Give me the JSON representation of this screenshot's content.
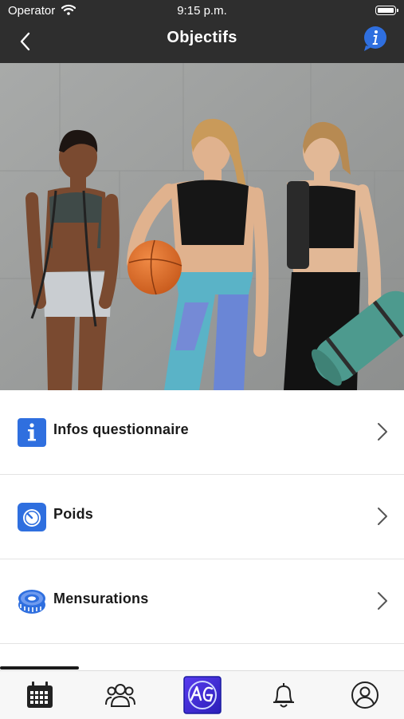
{
  "status_bar": {
    "carrier": "Operator",
    "time": "9:15 p.m.",
    "wifi_icon": "wifi-icon",
    "battery_icon": "battery-icon"
  },
  "nav": {
    "title": "Objectifs",
    "back_icon": "chevron-left-icon",
    "info_icon": "info-bubble-icon"
  },
  "hero": {
    "description_icon": "hero-photo"
  },
  "menu": {
    "items": [
      {
        "label": "Infos questionnaire",
        "icon": "info-square-icon"
      },
      {
        "label": "Poids",
        "icon": "scale-icon"
      },
      {
        "label": "Mensurations",
        "icon": "measuring-tape-icon"
      }
    ]
  },
  "tabbar": {
    "items": [
      {
        "icon": "calendar-icon"
      },
      {
        "icon": "group-icon"
      },
      {
        "icon": "app-logo-icon"
      },
      {
        "icon": "bell-icon"
      },
      {
        "icon": "profile-icon"
      }
    ]
  },
  "colors": {
    "header_bg": "#2e2e2e",
    "accent_blue": "#2f6fdf",
    "text_dark": "#1a1a1a"
  }
}
